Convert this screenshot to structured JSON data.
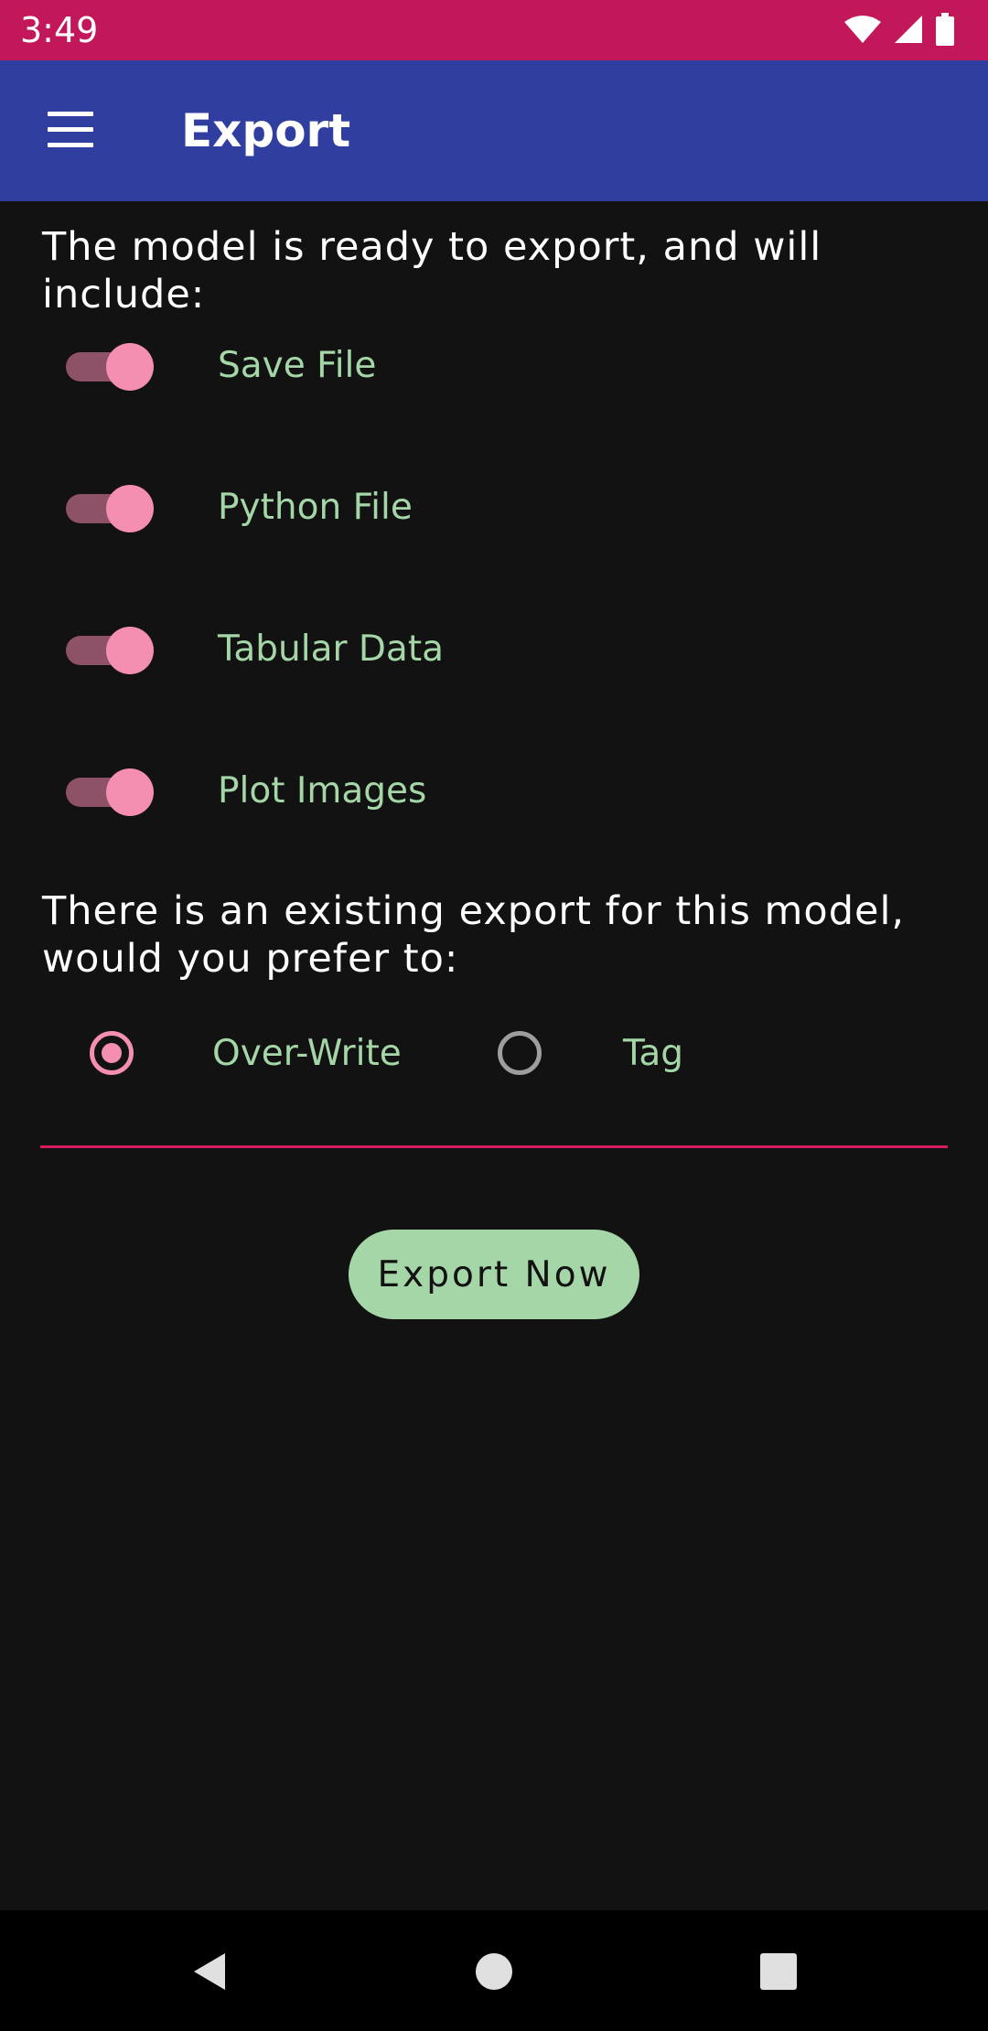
{
  "status_bar": {
    "time": "3:49",
    "icons": [
      "wifi-icon",
      "cellular-signal-icon",
      "battery-icon"
    ],
    "color": "#C2185B"
  },
  "app_bar": {
    "title": "Export",
    "menu_icon": "hamburger-menu-icon",
    "color": "#303F9F"
  },
  "intro": "The model is ready to export, and will include:",
  "toggles": [
    {
      "label": "Save File",
      "checked": true
    },
    {
      "label": "Python File",
      "checked": true
    },
    {
      "label": "Tabular Data",
      "checked": true
    },
    {
      "label": "Plot Images",
      "checked": true
    }
  ],
  "question": {
    "line1": "There is an existing export for this model,",
    "line2": "would you prefer to:"
  },
  "options": [
    {
      "label": "Over-Write",
      "selected": true
    },
    {
      "label": "Tag",
      "selected": false
    }
  ],
  "export_button": "Export Now",
  "colors": {
    "accent": "#F48FB1",
    "label_green": "#A5D6A7",
    "divider": "#D81B60",
    "background": "#121212"
  },
  "nav_bar": {
    "buttons": [
      "back-icon",
      "home-icon",
      "recents-icon"
    ]
  }
}
